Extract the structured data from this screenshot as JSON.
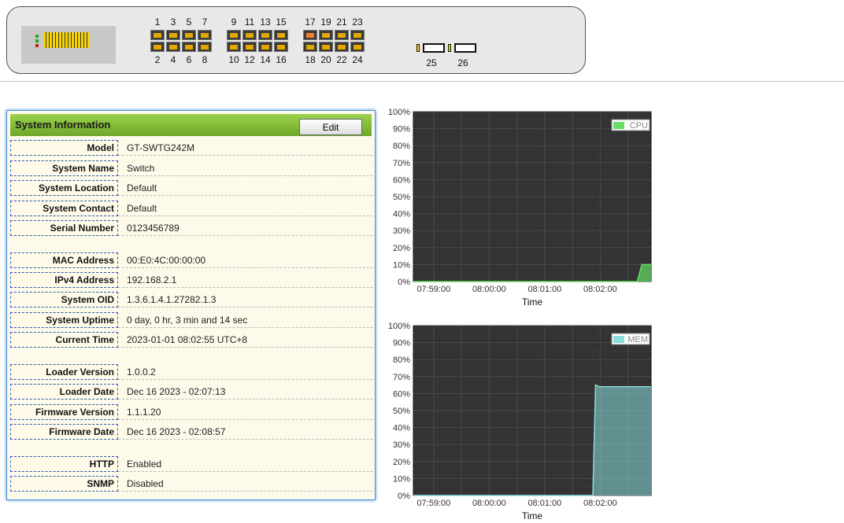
{
  "ports": {
    "top": [
      "1",
      "3",
      "5",
      "7",
      "9",
      "11",
      "13",
      "15",
      "17",
      "19",
      "21",
      "23"
    ],
    "bottom": [
      "2",
      "4",
      "6",
      "8",
      "10",
      "12",
      "14",
      "16",
      "18",
      "20",
      "22",
      "24"
    ],
    "sfp": [
      "25",
      "26"
    ],
    "active": [
      "17"
    ]
  },
  "system_info": {
    "title": "System Information",
    "edit_label": "Edit",
    "rows": [
      {
        "label": "Model",
        "value": "GT-SWTG242M"
      },
      {
        "label": "System Name",
        "value": "Switch"
      },
      {
        "label": "System Location",
        "value": "Default"
      },
      {
        "label": "System Contact",
        "value": "Default"
      },
      {
        "label": "Serial Number",
        "value": "0123456789"
      },
      {
        "label": "MAC Address",
        "value": "00:E0:4C:00:00:00"
      },
      {
        "label": "IPv4 Address",
        "value": "192.168.2.1"
      },
      {
        "label": "System OID",
        "value": "1.3.6.1.4.1.27282.1.3"
      },
      {
        "label": "System Uptime",
        "value": "0 day, 0 hr, 3 min and 14 sec"
      },
      {
        "label": "Current Time",
        "value": "2023-01-01 08:02:55 UTC+8"
      },
      {
        "label": "Loader Version",
        "value": "1.0.0.2"
      },
      {
        "label": "Loader Date",
        "value": "Dec 16 2023 - 02:07:13"
      },
      {
        "label": "Firmware Version",
        "value": "1.1.1.20"
      },
      {
        "label": "Firmware Date",
        "value": "Dec 16 2023 - 02:08:57"
      },
      {
        "label": "HTTP",
        "value": "Enabled"
      },
      {
        "label": "SNMP",
        "value": "Disabled"
      }
    ]
  },
  "chart_data": [
    {
      "type": "area",
      "series": [
        {
          "name": "CPU",
          "color": "#66dd66",
          "x": [
            "07:58:38",
            "08:02:40",
            "08:02:45",
            "08:02:55"
          ],
          "values": [
            0,
            0,
            10,
            10
          ]
        }
      ],
      "x_ticks": [
        "07:59:00",
        "08:00:00",
        "08:01:00",
        "08:02:00"
      ],
      "y_ticks": [
        "0%",
        "10%",
        "20%",
        "30%",
        "40%",
        "50%",
        "60%",
        "70%",
        "80%",
        "90%",
        "100%"
      ],
      "xlabel": "Time",
      "ylim": [
        0,
        100
      ],
      "legend": "top-right",
      "grid": true
    },
    {
      "type": "area",
      "series": [
        {
          "name": "MEM",
          "color": "#88dddd",
          "x": [
            "07:58:38",
            "08:01:52",
            "08:01:55",
            "08:01:59",
            "08:02:55"
          ],
          "values": [
            0,
            0,
            65,
            64,
            64
          ]
        }
      ],
      "x_ticks": [
        "07:59:00",
        "08:00:00",
        "08:01:00",
        "08:02:00"
      ],
      "y_ticks": [
        "0%",
        "10%",
        "20%",
        "30%",
        "40%",
        "50%",
        "60%",
        "70%",
        "80%",
        "90%",
        "100%"
      ],
      "xlabel": "Time",
      "ylim": [
        0,
        100
      ],
      "legend": "top-right",
      "grid": true
    }
  ]
}
